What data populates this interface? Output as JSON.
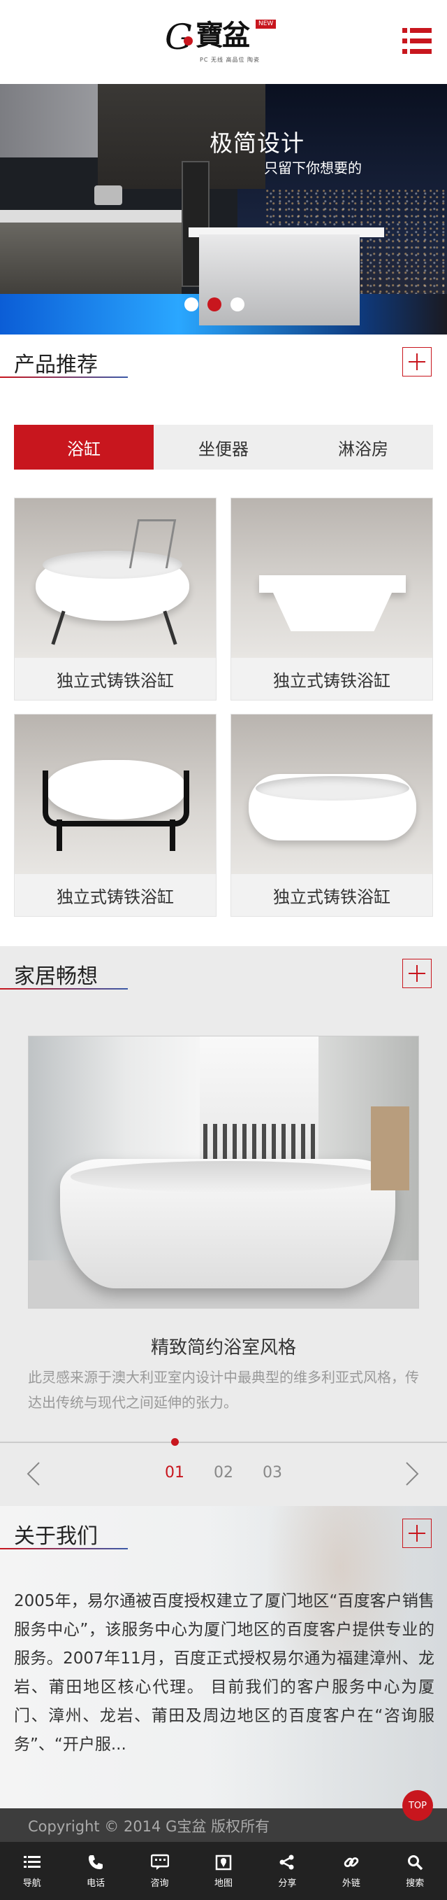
{
  "brand": {
    "logo_letter": "G",
    "logo_cn": "寶盆",
    "badge": "NEW",
    "slogan": "PC 无线 高品位 陶瓷"
  },
  "banner": {
    "title": "极简设计",
    "subtitle": "只留下你想要的",
    "slides": 3,
    "active_slide": 2
  },
  "products_section": {
    "title": "产品推荐",
    "tabs": [
      "浴缸",
      "坐便器",
      "淋浴房"
    ],
    "active_tab": 0,
    "items": [
      {
        "name": "独立式铸铁浴缸"
      },
      {
        "name": "独立式铸铁浴缸"
      },
      {
        "name": "独立式铸铁浴缸"
      },
      {
        "name": "独立式铸铁浴缸"
      }
    ]
  },
  "home_section": {
    "title": "家居畅想",
    "story_title": "精致简约浴室风格",
    "story_desc": "此灵感来源于澳大利亚室内设计中最典型的维多利亚式风格，传达出传统与现代之间延伸的张力。",
    "pages": [
      "01",
      "02",
      "03"
    ],
    "active_page": "01"
  },
  "about_section": {
    "title": "关于我们",
    "text": "2005年，易尔通被百度授权建立了厦门地区“百度客户销售服务中心”，该服务中心为厦门地区的百度客户提供专业的服务。2007年11月，百度正式授权易尔通为福建漳州、龙岩、莆田地区核心代理。 目前我们的客户服务中心为厦门、漳州、龙岩、莆田及周边地区的百度客户在“咨询服务”、“开户服..."
  },
  "footer": {
    "copyright": "Copyright © 2014 G宝盆 版权所有",
    "top_label": "TOP"
  },
  "navbar": [
    {
      "label": "导航",
      "icon": "list-icon"
    },
    {
      "label": "电话",
      "icon": "phone-icon"
    },
    {
      "label": "咨询",
      "icon": "chat-icon"
    },
    {
      "label": "地图",
      "icon": "map-icon"
    },
    {
      "label": "分享",
      "icon": "share-icon"
    },
    {
      "label": "外链",
      "icon": "link-icon"
    },
    {
      "label": "搜索",
      "icon": "search-icon"
    }
  ],
  "colors": {
    "accent": "#c8161e",
    "dark": "#222222",
    "footer": "#3d3d3d"
  }
}
